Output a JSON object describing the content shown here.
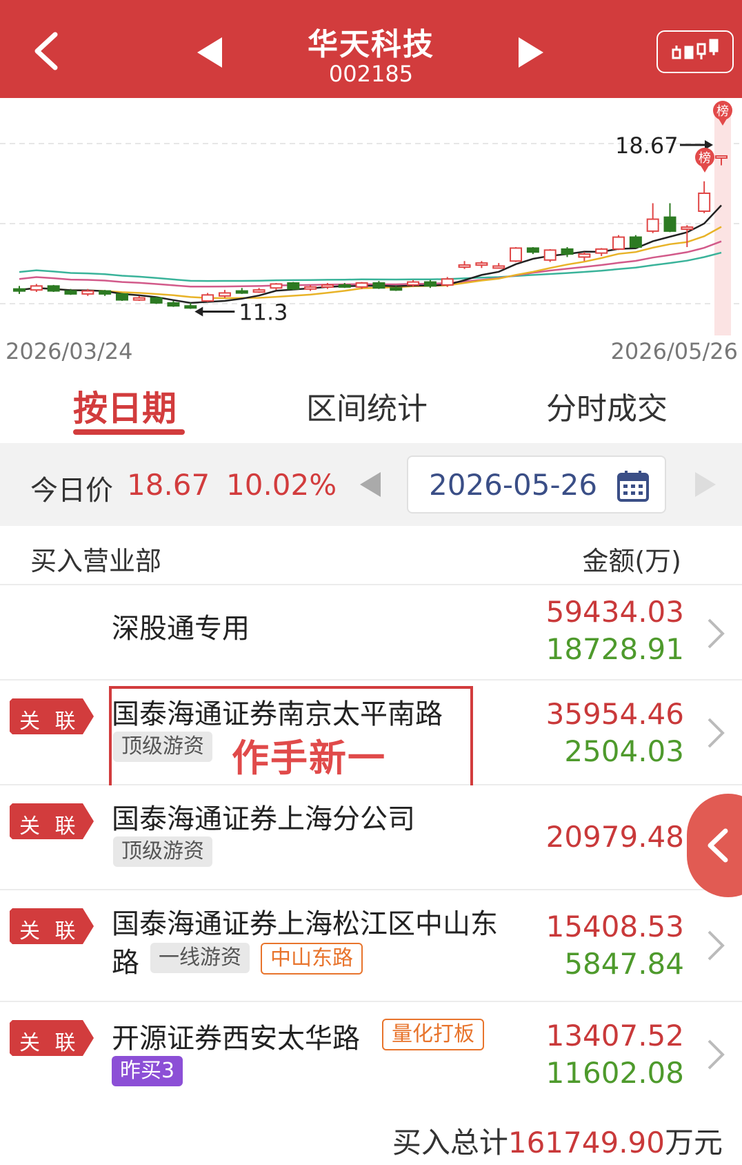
{
  "header": {
    "title": "华天科技",
    "code": "002185",
    "icons": [
      "back-arrow-icon",
      "prev-stock-icon",
      "next-stock-icon",
      "kline-icon"
    ]
  },
  "chart_data": {
    "type": "candlestick",
    "x_start_label": "2026/03/24",
    "x_end_label": "2026/05/26",
    "high_annotation": "18.67",
    "low_annotation": "11.3",
    "badge_text": "榜",
    "ylim": [
      10.5,
      19.5
    ],
    "candles": [
      {
        "o": 12.0,
        "c": 11.95,
        "h": 12.15,
        "l": 11.75
      },
      {
        "o": 11.95,
        "c": 12.15,
        "h": 12.25,
        "l": 11.85
      },
      {
        "o": 12.15,
        "c": 11.9,
        "h": 12.2,
        "l": 11.85
      },
      {
        "o": 11.9,
        "c": 11.75,
        "h": 12.0,
        "l": 11.7
      },
      {
        "o": 11.75,
        "c": 11.9,
        "h": 12.0,
        "l": 11.65
      },
      {
        "o": 11.9,
        "c": 11.75,
        "h": 11.95,
        "l": 11.65
      },
      {
        "o": 11.75,
        "c": 11.45,
        "h": 11.8,
        "l": 11.4
      },
      {
        "o": 11.45,
        "c": 11.55,
        "h": 11.65,
        "l": 11.4
      },
      {
        "o": 11.55,
        "c": 11.3,
        "h": 11.6,
        "l": 11.25
      },
      {
        "o": 11.3,
        "c": 11.15,
        "h": 11.4,
        "l": 11.1
      },
      {
        "o": 11.15,
        "c": 11.05,
        "h": 11.3,
        "l": 11.0
      },
      {
        "o": 11.4,
        "c": 11.7,
        "h": 11.8,
        "l": 11.35
      },
      {
        "o": 11.65,
        "c": 11.8,
        "h": 11.95,
        "l": 11.55
      },
      {
        "o": 11.9,
        "c": 11.85,
        "h": 12.05,
        "l": 11.75
      },
      {
        "o": 11.85,
        "c": 11.95,
        "h": 12.05,
        "l": 11.8
      },
      {
        "o": 12.05,
        "c": 12.25,
        "h": 12.3,
        "l": 11.95
      },
      {
        "o": 12.3,
        "c": 12.0,
        "h": 12.35,
        "l": 11.95
      },
      {
        "o": 12.0,
        "c": 12.1,
        "h": 12.2,
        "l": 11.9
      },
      {
        "o": 12.1,
        "c": 12.2,
        "h": 12.3,
        "l": 12.0
      },
      {
        "o": 12.2,
        "c": 12.15,
        "h": 12.3,
        "l": 12.05
      },
      {
        "o": 12.1,
        "c": 12.3,
        "h": 12.35,
        "l": 12.0
      },
      {
        "o": 12.3,
        "c": 12.05,
        "h": 12.4,
        "l": 12.0
      },
      {
        "o": 12.05,
        "c": 12.0,
        "h": 12.15,
        "l": 11.9
      },
      {
        "o": 12.2,
        "c": 12.35,
        "h": 12.45,
        "l": 12.1
      },
      {
        "o": 12.35,
        "c": 12.15,
        "h": 12.45,
        "l": 12.05
      },
      {
        "o": 12.2,
        "c": 12.5,
        "h": 12.6,
        "l": 12.1
      },
      {
        "o": 13.15,
        "c": 13.2,
        "h": 13.4,
        "l": 13.0
      },
      {
        "o": 13.2,
        "c": 13.3,
        "h": 13.4,
        "l": 13.05
      },
      {
        "o": 13.1,
        "c": 13.15,
        "h": 13.3,
        "l": 13.05
      },
      {
        "o": 13.4,
        "c": 14.05,
        "h": 14.1,
        "l": 13.35
      },
      {
        "o": 14.05,
        "c": 13.85,
        "h": 14.1,
        "l": 13.75
      },
      {
        "o": 13.45,
        "c": 13.95,
        "h": 14.0,
        "l": 13.35
      },
      {
        "o": 14.0,
        "c": 13.75,
        "h": 14.1,
        "l": 13.6
      },
      {
        "o": 13.6,
        "c": 13.75,
        "h": 13.85,
        "l": 13.4
      },
      {
        "o": 13.8,
        "c": 14.0,
        "h": 14.05,
        "l": 13.65
      },
      {
        "o": 14.0,
        "c": 14.6,
        "h": 14.7,
        "l": 13.95
      },
      {
        "o": 14.6,
        "c": 14.1,
        "h": 14.7,
        "l": 14.05
      },
      {
        "o": 14.9,
        "c": 15.5,
        "h": 16.3,
        "l": 14.8
      },
      {
        "o": 15.6,
        "c": 14.9,
        "h": 16.3,
        "l": 14.85
      },
      {
        "o": 15.1,
        "c": 15.1,
        "h": 15.2,
        "l": 14.1
      },
      {
        "o": 15.9,
        "c": 16.8,
        "h": 17.4,
        "l": 15.8
      },
      {
        "o": 18.67,
        "c": 18.67,
        "h": 18.67,
        "l": 18.2
      }
    ]
  },
  "tabs": [
    {
      "label": "按日期",
      "active": true
    },
    {
      "label": "区间统计",
      "active": false
    },
    {
      "label": "分时成交",
      "active": false
    }
  ],
  "pricebar": {
    "label": "今日价",
    "price": "18.67",
    "change": "10.02%",
    "date": "2026-05-26"
  },
  "table_header": {
    "left": "买入营业部",
    "right": "金额(万)"
  },
  "rows": [
    {
      "name": "深股通专用",
      "buy": "59434.03",
      "sell": "18728.91"
    },
    {
      "link": "关 联",
      "name": "国泰海通证券南京太平南路",
      "tag_gray": "顶级游资",
      "buy": "35954.46",
      "sell": "2504.03"
    },
    {
      "link": "关 联",
      "name": "国泰海通证券上海分公司",
      "tag_gray": "顶级游资",
      "buy": "20979.48",
      "sell": ""
    },
    {
      "link": "关 联",
      "name_line1": "国泰海通证券上海松江区中山东",
      "name_line2": "路",
      "tag_gray": "一线游资",
      "tag_orange": "中山东路",
      "buy": "15408.53",
      "sell": "5847.84"
    },
    {
      "link": "关 联",
      "name": "开源证券西安太华路",
      "tag_orange": "量化打板",
      "tag_purple": "昨买3",
      "buy": "13407.52",
      "sell": "11602.08"
    }
  ],
  "annotation": "作手新一",
  "footer": {
    "label": "买入总计",
    "total": "161749.90",
    "unit": "万元"
  },
  "colors": {
    "brand_red": "#d23c3d",
    "up": "#e04646",
    "down": "#2c7a22",
    "ma5": "#222222",
    "ma10": "#e8b328",
    "ma20": "#d25a8a",
    "ma60": "#3ab39a"
  }
}
